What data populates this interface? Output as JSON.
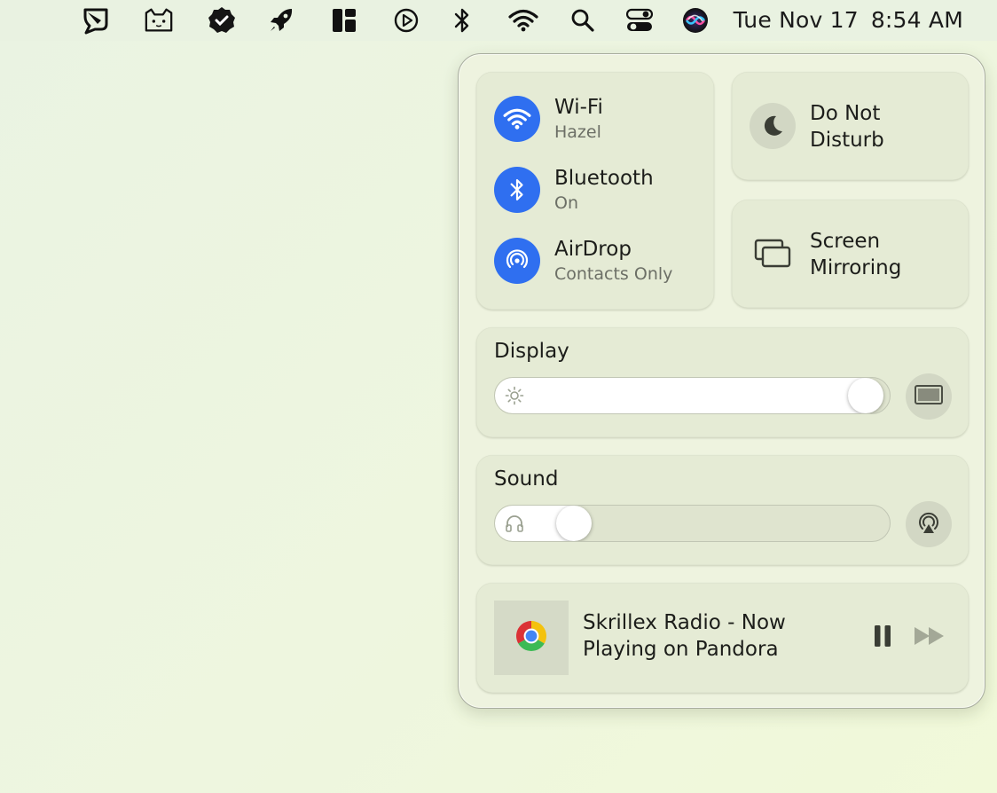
{
  "menubar": {
    "icons": [
      "chat-bubble-icon",
      "cat-icon",
      "checkmark-badge-icon",
      "rocket-icon",
      "layout-grid-icon",
      "play-circle-icon",
      "bluetooth-icon",
      "wifi-icon",
      "search-icon",
      "control-center-icon",
      "siri-icon"
    ],
    "date": "Tue Nov 17",
    "time": "8:54 AM"
  },
  "control_center": {
    "network": [
      {
        "title": "Wi-Fi",
        "subtitle": "Hazel",
        "icon": "wifi-icon"
      },
      {
        "title": "Bluetooth",
        "subtitle": "On",
        "icon": "bluetooth-icon"
      },
      {
        "title": "AirDrop",
        "subtitle": "Contacts Only",
        "icon": "airdrop-icon"
      }
    ],
    "do_not_disturb": {
      "line1": "Do Not",
      "line2": "Disturb",
      "icon": "moon-icon"
    },
    "screen_mirroring": {
      "line1": "Screen",
      "line2": "Mirroring",
      "icon": "screen-mirroring-icon"
    },
    "display": {
      "title": "Display",
      "brightness_fraction": 0.94,
      "icon": "sun-icon",
      "side_icon": "display-icon"
    },
    "sound": {
      "title": "Sound",
      "volume_fraction": 0.2,
      "icon": "headphones-icon",
      "side_icon": "airplay-audio-icon"
    },
    "now_playing": {
      "title": "Skrillex Radio - Now Playing on Pandora",
      "app_icon": "chrome-icon",
      "controls": [
        "pause-icon",
        "fast-forward-icon"
      ]
    }
  },
  "colors": {
    "accent": "#2f6ff0",
    "tile": "#e5ebd5",
    "panel": "#eef3df"
  }
}
